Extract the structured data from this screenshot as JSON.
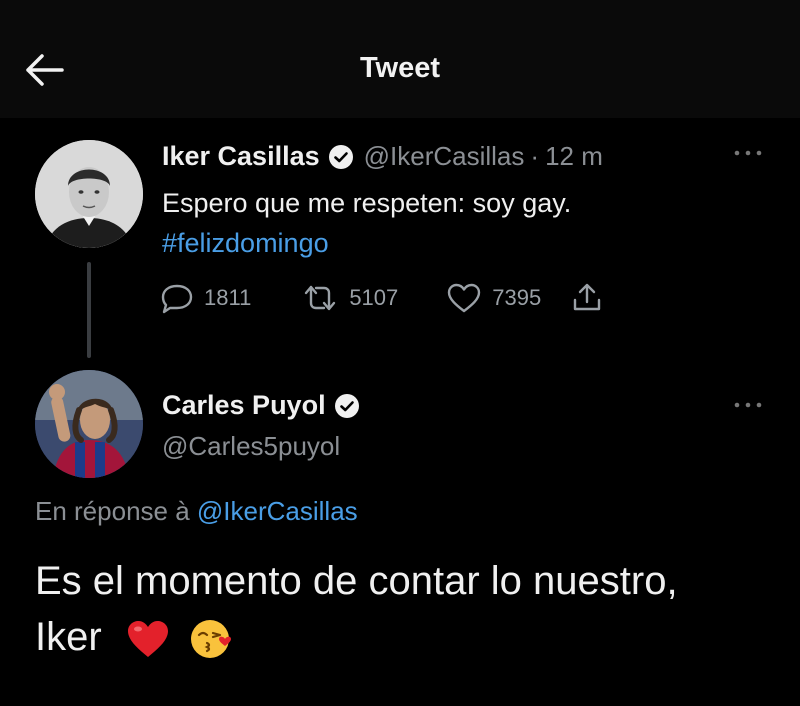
{
  "header": {
    "title": "Tweet",
    "back_icon": "arrow-left-icon"
  },
  "tweet1": {
    "display_name": "Iker Casillas",
    "handle": "@IkerCasillas",
    "separator": "·",
    "time": "12 m",
    "text": "Espero que me respeten: soy gay.",
    "hashtag": "#felizdomingo",
    "replies": "1811",
    "retweets": "5107",
    "likes": "7395"
  },
  "tweet2": {
    "display_name": "Carles Puyol",
    "handle": "@Carles5puyol",
    "reply_prefix": "En réponse à",
    "reply_handle": "@IkerCasillas",
    "text_line1": "Es el momento de contar lo nuestro,",
    "text_line2": "Iker"
  },
  "colors": {
    "link": "#4a9ee6",
    "muted": "#8b8f94",
    "background": "#000000"
  }
}
